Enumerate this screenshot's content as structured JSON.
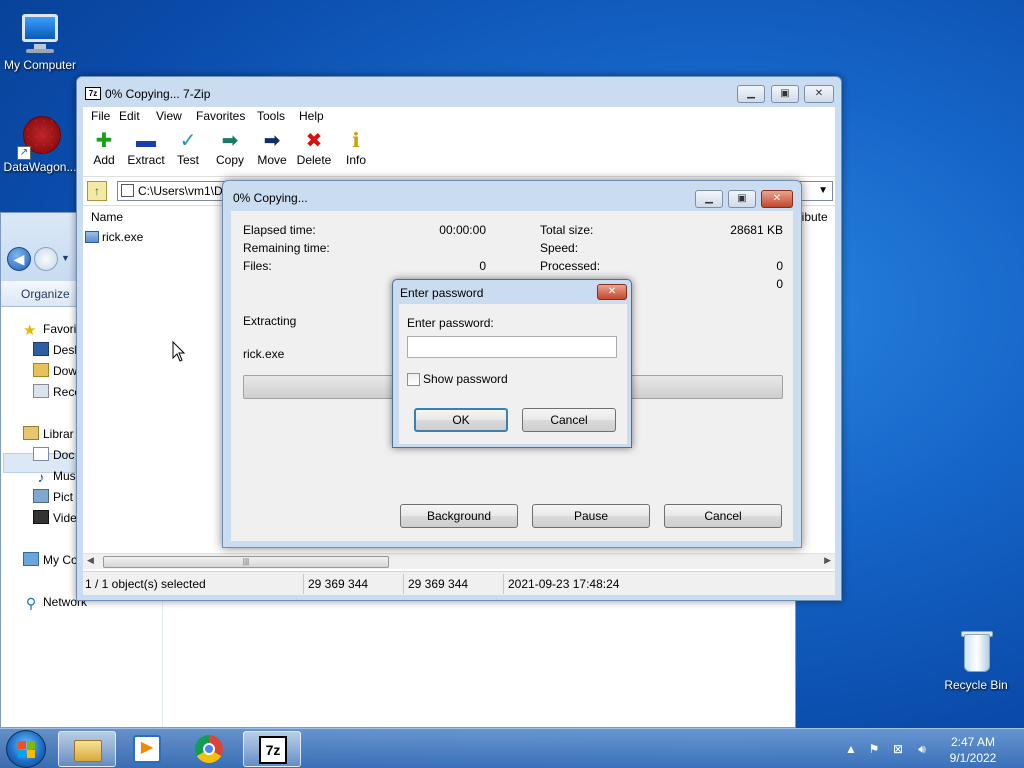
{
  "desktop": {
    "icons": [
      {
        "label": "My Computer"
      },
      {
        "label": "DataWagon..."
      },
      {
        "label": "Recycle Bin"
      }
    ]
  },
  "explorer": {
    "organize_label": "Organize",
    "tree": [
      {
        "label": "Favori"
      },
      {
        "label": "Desk"
      },
      {
        "label": "Dow"
      },
      {
        "label": "Rece"
      },
      {
        "label": "Librar"
      },
      {
        "label": "Doc"
      },
      {
        "label": "Mus"
      },
      {
        "label": "Pict"
      },
      {
        "label": "Vide"
      },
      {
        "label": "My Co"
      },
      {
        "label": "Network"
      }
    ]
  },
  "sevenzip": {
    "title": "0% Copying... 7-Zip",
    "app_icon": "7z",
    "menu": [
      "File",
      "Edit",
      "View",
      "Favorites",
      "Tools",
      "Help"
    ],
    "tools": [
      {
        "label": "Add",
        "icon": "plus-icon",
        "glyph": "✚",
        "color": "#1aa01a"
      },
      {
        "label": "Extract",
        "icon": "minus-icon",
        "glyph": "▬",
        "color": "#1a3fa8"
      },
      {
        "label": "Test",
        "icon": "check-icon",
        "glyph": "✓",
        "color": "#1a9aa8"
      },
      {
        "label": "Copy",
        "icon": "copy-arrow-icon",
        "glyph": "➡",
        "color": "#1a7a6a"
      },
      {
        "label": "Move",
        "icon": "move-arrow-icon",
        "glyph": "➡",
        "color": "#0d2f6b"
      },
      {
        "label": "Delete",
        "icon": "delete-x-icon",
        "glyph": "✖",
        "color": "#d81010"
      },
      {
        "label": "Info",
        "icon": "info-icon",
        "glyph": "ℹ",
        "color": "#c7a400"
      }
    ],
    "address": "C:\\Users\\vm1\\D",
    "columns": {
      "name": "Name",
      "attributes": "ttribute"
    },
    "files": [
      {
        "name": "rick.exe"
      }
    ],
    "status": {
      "selected": "1 / 1 object(s) selected",
      "size": "29 369 344",
      "packed": "29 369 344",
      "modified": "2021-09-23 17:48:24"
    }
  },
  "progress": {
    "title": "0% Copying...",
    "elapsed_label": "Elapsed time:",
    "elapsed_value": "00:00:00",
    "remaining_label": "Remaining time:",
    "files_label": "Files:",
    "files_value": "0",
    "total_size_label": "Total size:",
    "total_size_value": "28681 KB",
    "speed_label": "Speed:",
    "processed_label": "Processed:",
    "processed_value": "0",
    "extra_value": "0",
    "action_label": "Extracting",
    "current_file": "rick.exe",
    "percent": 0,
    "buttons": {
      "background": "Background",
      "pause": "Pause",
      "cancel": "Cancel"
    }
  },
  "password_dialog": {
    "title": "Enter password",
    "prompt": "Enter password:",
    "password_value": "",
    "show_password_label": "Show password",
    "show_password_checked": false,
    "ok_label": "OK",
    "cancel_label": "Cancel"
  },
  "taskbar": {
    "time": "2:47 AM",
    "date": "9/1/2022",
    "pinned": [
      {
        "name": "explorer",
        "icon": "folder-icon"
      },
      {
        "name": "media-player",
        "icon": "media-player-icon"
      },
      {
        "name": "chrome",
        "icon": "chrome-icon"
      },
      {
        "name": "7zip",
        "icon": "7zip-icon",
        "label": "7z"
      }
    ]
  },
  "colors": {
    "desktop_blue": "#1565c8",
    "window_frame": "#cadcf0",
    "dialog_face": "#f0f0f0"
  }
}
